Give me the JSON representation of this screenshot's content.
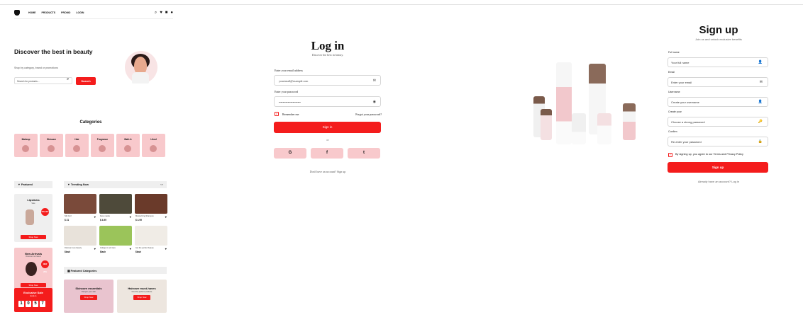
{
  "colors": {
    "accent": "#f41c1c",
    "pink": "#f8c9cc",
    "grey": "#efefef"
  },
  "home": {
    "nav": {
      "links": [
        "HOME",
        "PRODUCTS",
        "PROMO",
        "LOGIN"
      ],
      "icons": [
        "search-icon",
        "heart-icon",
        "bag-icon",
        "user-icon"
      ]
    },
    "hero": {
      "title": "Discover the best in beauty",
      "subtitle": "Shop by category, brand or promotions",
      "search_placeholder": "Search for products...",
      "search_button": "Search"
    },
    "categories": {
      "title": "Categories",
      "items": [
        "Makeup",
        "Skincare",
        "Hair",
        "Fragrance",
        "Bath &",
        "Liked"
      ]
    },
    "featured": {
      "title": "Featured",
      "card1": {
        "title": "Lipsticks",
        "sub": "Sale",
        "badge": "30% OFF",
        "button": "Shop Now"
      },
      "card2": {
        "title": "New Arrivals",
        "sub": "Discover our latest",
        "badge": "NEW 20%",
        "button": "Shop Now"
      },
      "card3": {
        "title": "Exclusive Sale",
        "sub": "Ends in",
        "digits": [
          "1",
          "0",
          "5",
          "7"
        ]
      }
    },
    "trending": {
      "title": "Trending Now",
      "arrows": "‹ ›",
      "items": [
        {
          "name": "Silk Curl",
          "price": "$ 21"
        },
        {
          "name": "Face masks",
          "price": "$ 4.99"
        },
        {
          "name": "Moisturizing Shampoo",
          "price": "$ 4.99"
        },
        {
          "name": "Discover new beauty",
          "price": "$lash"
        },
        {
          "name": "Indulge in self care",
          "price": "$lash"
        },
        {
          "name": "Get the perfect beauty",
          "price": "$lash"
        }
      ]
    },
    "featured_categories": {
      "title": "Featured Categories",
      "items": [
        {
          "title": "Skincare essentials",
          "sub": "Pamper your skin",
          "button": "Shop Now"
        },
        {
          "title": "Haircare must-haves",
          "sub": "Find the perfect products",
          "button": "Shop Now"
        }
      ]
    }
  },
  "login": {
    "title": "Log in",
    "subtitle": "Discover the best in beauty.",
    "email_label": "Enter your email address",
    "email_value": "youremail@example.com",
    "password_label": "Enter your password",
    "password_value": "••••••••••••••••••••••",
    "remember": "Remember me",
    "forgot": "Forgot your password?",
    "button": "Sign in",
    "or": "or",
    "social": [
      "G",
      "f",
      "t"
    ],
    "footer": "Don't have an account? Sign up"
  },
  "signup": {
    "title": "Sign up",
    "subtitle": "Join us and unlock exclusive benefits",
    "fields": [
      {
        "label": "Full name",
        "placeholder": "Your full name",
        "icon": "user-icon"
      },
      {
        "label": "Email",
        "placeholder": "Enter your email",
        "icon": "mail-icon"
      },
      {
        "label": "Username",
        "placeholder": "Create your username",
        "icon": "user-icon"
      },
      {
        "label": "Create your",
        "placeholder": "Choose a strong password",
        "icon": "key-icon"
      },
      {
        "label": "Confirm",
        "placeholder": "Re-enter your password",
        "icon": "lock-icon"
      }
    ],
    "terms": "By signing up, you agree to our Terms and Privacy Policy",
    "button": "Sign up",
    "footer": "Already have an account? Log in"
  }
}
